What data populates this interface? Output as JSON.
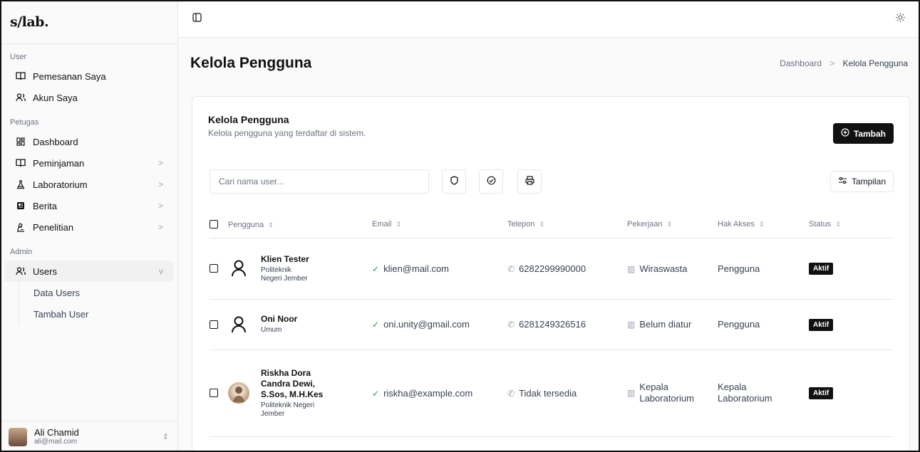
{
  "app": {
    "logo": "s/lab."
  },
  "sidebar": {
    "sections": {
      "user": "User",
      "petugas": "Petugas",
      "admin": "Admin"
    },
    "user_items": [
      {
        "label": "Pemesanan Saya",
        "icon": "book-open-icon"
      },
      {
        "label": "Akun Saya",
        "icon": "users-icon"
      }
    ],
    "petugas_items": [
      {
        "label": "Dashboard",
        "icon": "grid-icon"
      },
      {
        "label": "Peminjaman",
        "icon": "book-open-icon",
        "chevron": ">"
      },
      {
        "label": "Laboratorium",
        "icon": "flask-icon",
        "chevron": ">"
      },
      {
        "label": "Berita",
        "icon": "newspaper-icon",
        "chevron": ">"
      },
      {
        "label": "Penelitian",
        "icon": "microscope-icon",
        "chevron": ">"
      }
    ],
    "admin_items": [
      {
        "label": "Users",
        "icon": "users-icon",
        "chevron": "v"
      }
    ],
    "users_sub": [
      {
        "label": "Data Users"
      },
      {
        "label": "Tambah User"
      }
    ],
    "current_user": {
      "name": "Ali Chamid",
      "email": "ali@mail.com"
    }
  },
  "header": {
    "title": "Kelola Pengguna",
    "breadcrumb": [
      "Dashboard",
      "Kelola Pengguna"
    ],
    "breadcrumb_sep": ">"
  },
  "card": {
    "title": "Kelola Pengguna",
    "subtitle": "Kelola pengguna yang terdaftar di sistem.",
    "add_label": "Tambah",
    "search_placeholder": "Cari nama user...",
    "view_label": "Tampilan"
  },
  "table": {
    "columns": [
      "Pengguna",
      "Email",
      "Telepon",
      "Pekerjaan",
      "Hak Akses",
      "Status"
    ],
    "rows": [
      {
        "name": "Klien Tester",
        "org": "Politeknik Negeri Jember",
        "email": "klien@mail.com",
        "phone": "6282299990000",
        "job": "Wiraswasta",
        "role": "Pengguna",
        "status": "Aktif"
      },
      {
        "name": "Oni Noor",
        "org": "Umum",
        "email": "oni.unity@gmail.com",
        "phone": "6281249326516",
        "job": "Belum diatur",
        "role": "Pengguna",
        "status": "Aktif"
      },
      {
        "name": "Riskha Dora Candra Dewi, S.Sos, M.H.Kes",
        "org": "Politeknik Negeri Jember",
        "email": "riskha@example.com",
        "phone": "Tidak tersedia",
        "job": "Kepala Laboratorium",
        "role": "Kepala Laboratorium",
        "status": "Aktif"
      }
    ]
  },
  "colors": {
    "primary": "#111111",
    "border": "#e5e7eb",
    "muted": "#6b7280",
    "ok": "#16a34a"
  }
}
